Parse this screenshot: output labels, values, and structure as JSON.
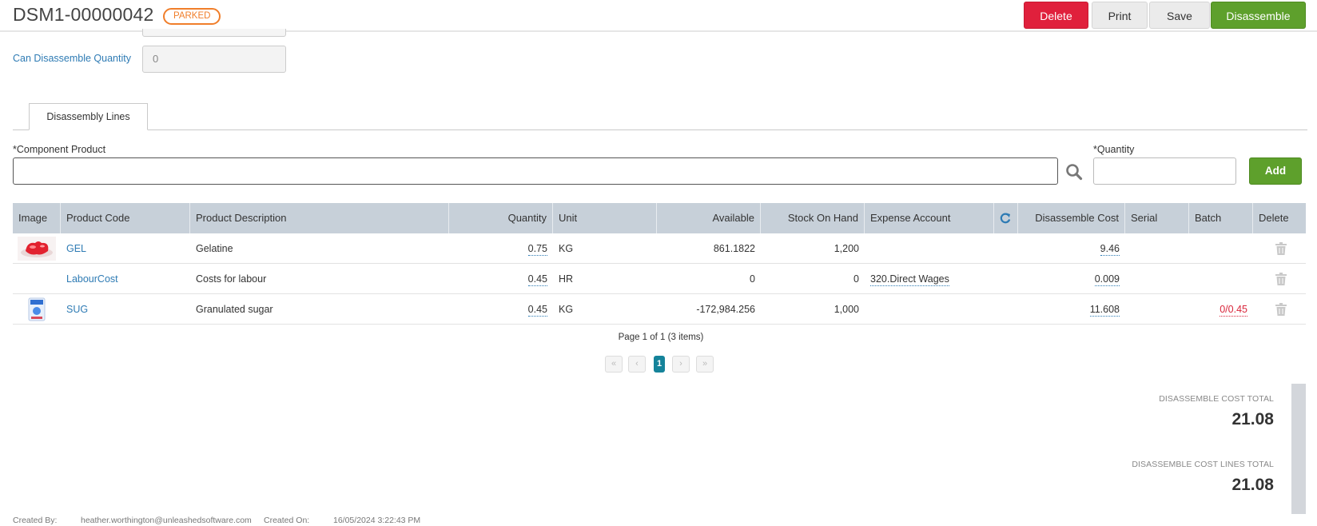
{
  "header": {
    "title": "DSM1-00000042",
    "status": "PARKED",
    "buttons": {
      "delete": "Delete",
      "print": "Print",
      "save": "Save",
      "disassemble": "Disassemble"
    }
  },
  "form": {
    "can_disassemble_label": "Can Disassemble Quantity",
    "can_disassemble_value": "0"
  },
  "tabs": [
    {
      "label": "Disassembly Lines"
    }
  ],
  "add_line": {
    "component_label": "*Component Product",
    "component_value": "",
    "quantity_label": "*Quantity",
    "quantity_value": "",
    "add_label": "Add"
  },
  "table": {
    "columns": [
      "Image",
      "Product Code",
      "Product Description",
      "Quantity",
      "Unit",
      "Available",
      "Stock On Hand",
      "Expense Account",
      "Disassemble Cost",
      "Serial",
      "Batch",
      "Delete"
    ],
    "rows": [
      {
        "image": "red-gelatin-thumbnail",
        "code": "GEL",
        "description": "Gelatine",
        "quantity": "0.75",
        "unit": "KG",
        "available": "861.1822",
        "stock_on_hand": "1,200",
        "expense_account": "",
        "cost": "9.46",
        "serial": "",
        "batch": ""
      },
      {
        "image": "",
        "code": "LabourCost",
        "description": "Costs for labour",
        "quantity": "0.45",
        "unit": "HR",
        "available": "0",
        "stock_on_hand": "0",
        "expense_account": "320.Direct Wages",
        "cost": "0.009",
        "serial": "",
        "batch": ""
      },
      {
        "image": "sugar-bag-thumbnail",
        "code": "SUG",
        "description": "Granulated sugar",
        "quantity": "0.45",
        "unit": "KG",
        "available": "-172,984.256",
        "stock_on_hand": "1,000",
        "expense_account": "",
        "cost": "11.608",
        "serial": "",
        "batch": "0/0.45"
      }
    ]
  },
  "pager": {
    "summary": "Page 1 of 1 (3 items)",
    "current_page": "1",
    "first": "«",
    "prev": "‹",
    "next": "›",
    "last": "»"
  },
  "totals": {
    "cost_total_label": "DISASSEMBLE COST TOTAL",
    "cost_total_value": "21.08",
    "lines_total_label": "DISASSEMBLE COST LINES TOTAL",
    "lines_total_value": "21.08"
  },
  "footer": {
    "created_by_label": "Created By:",
    "created_by": "heather.worthington@unleashedsoftware.com",
    "created_on_label": "Created On:",
    "created_on": "16/05/2024 3:22:43 PM"
  },
  "colors": {
    "primary_green": "#5ea02c",
    "danger_red": "#e0203c",
    "link_blue": "#2e7bb4",
    "parked_orange": "#f07e2a",
    "grid_header": "#c7d0d9"
  }
}
